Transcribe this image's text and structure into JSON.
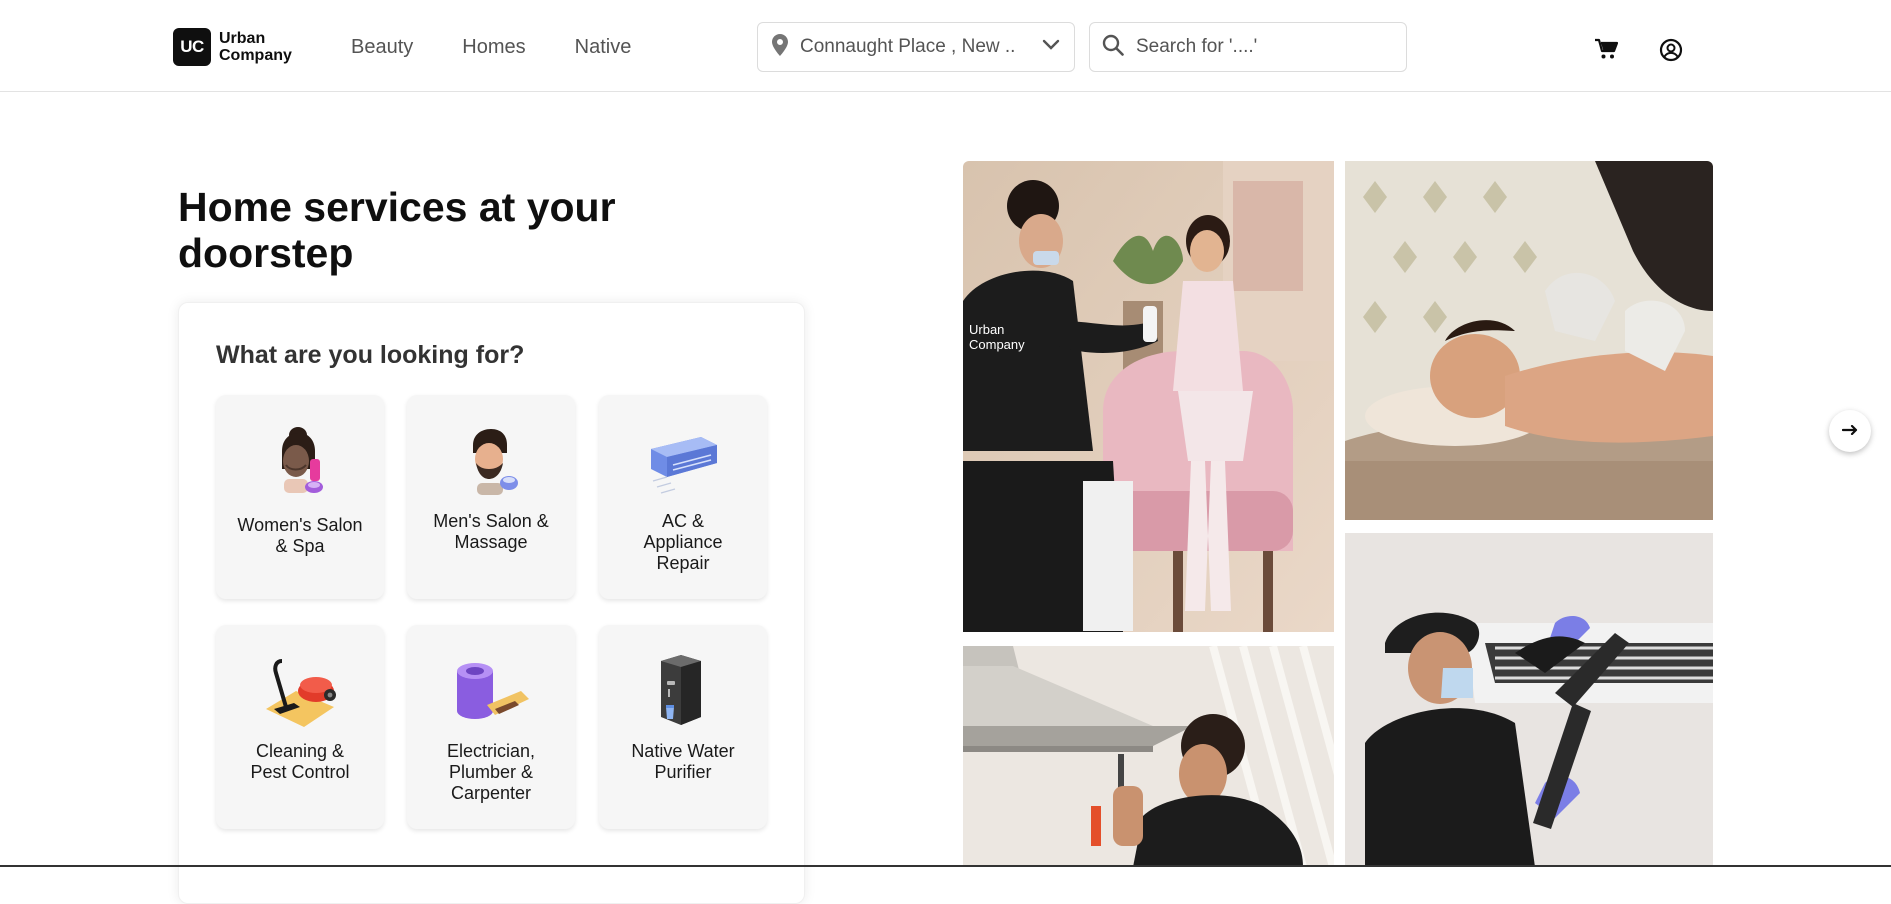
{
  "header": {
    "logo_badge": "UC",
    "logo_line1": "Urban",
    "logo_line2": "Company",
    "nav": [
      "Beauty",
      "Homes",
      "Native"
    ],
    "location": "Connaught Place , New ..",
    "search_placeholder": "Search for '....'"
  },
  "hero": {
    "title_line1": "Home services at your",
    "title_line2": "doorstep"
  },
  "panel": {
    "title": "What are you looking for?",
    "services": [
      {
        "label_line1": "Women's Salon",
        "label_line2": "& Spa",
        "label_line3": "",
        "icon": "womens-salon-icon"
      },
      {
        "label_line1": "Men's Salon &",
        "label_line2": "Massage",
        "label_line3": "",
        "icon": "mens-salon-icon"
      },
      {
        "label_line1": "AC &",
        "label_line2": "Appliance",
        "label_line3": "Repair",
        "icon": "ac-icon"
      },
      {
        "label_line1": "Cleaning &",
        "label_line2": "Pest Control",
        "label_line3": "",
        "icon": "vacuum-icon"
      },
      {
        "label_line1": "Electrician,",
        "label_line2": "Plumber &",
        "label_line3": "Carpenter",
        "icon": "tools-icon"
      },
      {
        "label_line1": "Native Water",
        "label_line2": "Purifier",
        "label_line3": "",
        "icon": "water-purifier-icon"
      }
    ]
  },
  "photos": {
    "p1_badge_line1": "Urban",
    "p1_badge_line2": "Company"
  },
  "colors": {
    "brand": "#0f0f0f",
    "tile_bg": "#f6f6f6",
    "nav_text": "#545454"
  }
}
